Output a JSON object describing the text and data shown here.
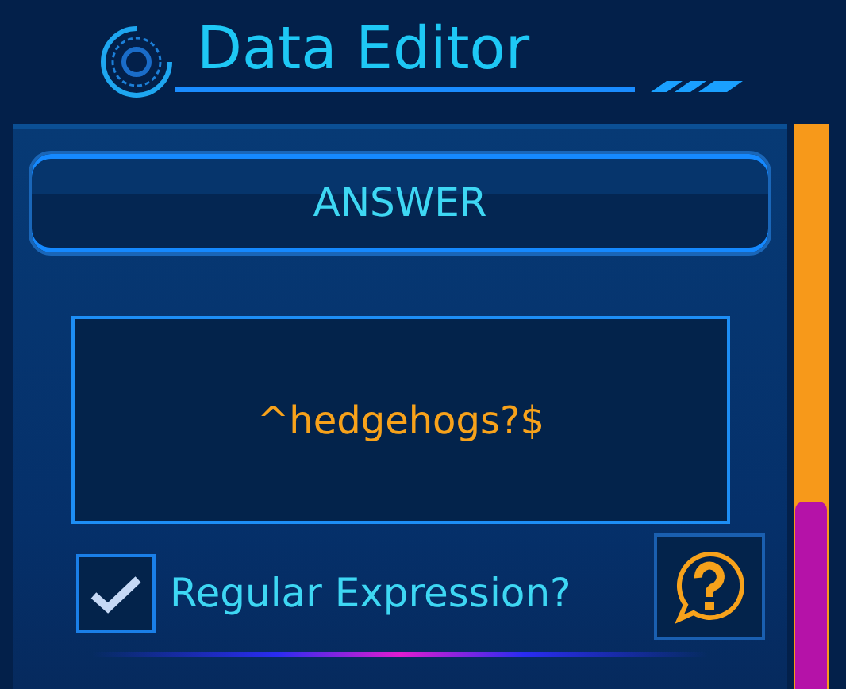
{
  "window": {
    "title": "Data Editor"
  },
  "section": {
    "heading": "ANSWER"
  },
  "answer": {
    "value": "^hedgehogs?$"
  },
  "regex_option": {
    "label": "Regular Expression?",
    "checked": true
  }
}
